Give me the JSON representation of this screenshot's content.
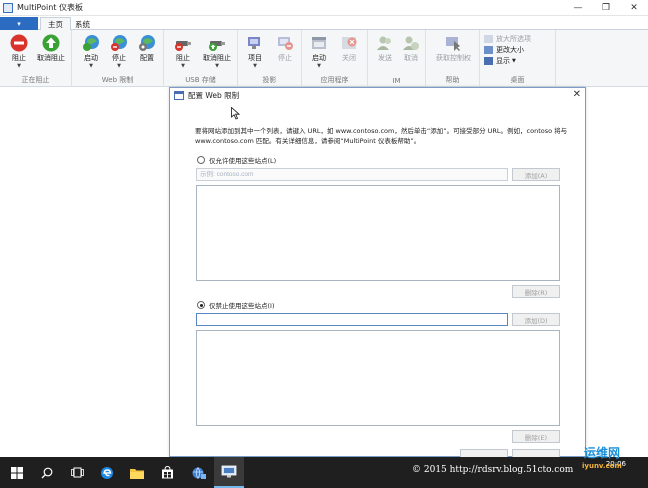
{
  "window": {
    "title": "MultiPoint 仪表板",
    "minimize_glyph": "—",
    "maximize_glyph": "❐",
    "close_glyph": "✕"
  },
  "ribbon_tabs": {
    "file_glyph": "▾",
    "home": "主页",
    "system": "系统"
  },
  "ribbon": {
    "block_group": {
      "label": "正在阻止",
      "block": "阻止",
      "unblock": "取消阻止"
    },
    "web_group": {
      "label": "Web 限制",
      "start": "启动",
      "stop": "停止",
      "configure": "配置"
    },
    "usb_group": {
      "label": "USB 存储",
      "block": "阻止",
      "unblock": "取消阻止"
    },
    "projection_group": {
      "label": "投影",
      "project": "项目",
      "stop": "停止"
    },
    "apps_group": {
      "label": "应用程序",
      "start": "启动",
      "close": "关闭"
    },
    "im_group": {
      "label": "IM",
      "send": "发送",
      "cancel": "取消"
    },
    "help_group": {
      "label": "帮助",
      "take_control": "获取控制权"
    },
    "desktop_group": {
      "label": "桌面",
      "enlarge_all": "放大所选项",
      "change_size": "更改大小",
      "display": "显示"
    }
  },
  "dialog": {
    "title": "配置 Web 限制",
    "close_glyph": "✕",
    "description": "要将网站添加到其中一个列表，请键入 URL，如 www.contoso.com，然后单击“添加”。可接受部分 URL。例如，contoso 将与 www.contoso.com 匹配。有关详细信息，请参阅“MultiPoint 仪表板帮助”。",
    "allow_option": "仅允许使用这些站点(L)",
    "allow_placeholder": "示例: contoso.com",
    "allow_add": "添加(A)",
    "allow_remove": "删除(R)",
    "block_option": "仅禁止使用这些站点(I)",
    "block_add": "添加(D)",
    "block_remove": "删除(E)"
  },
  "taskbar": {
    "watermark": "© 2015 http://rdsrv.blog.51cto.com",
    "time": "20:06",
    "brand": "运维网",
    "brand_sub": "iyunv.com"
  },
  "colors": {
    "accent": "#2b6cc2",
    "block_red": "#d9342b",
    "unblock_green": "#3aa235",
    "taskbar": "#1f1f1f"
  }
}
